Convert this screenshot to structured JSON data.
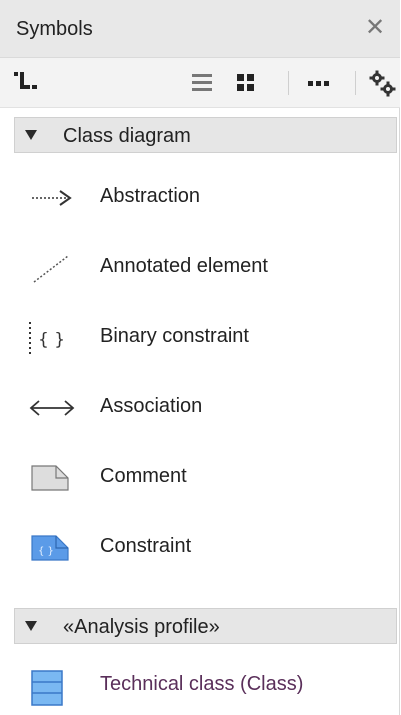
{
  "panel": {
    "title": "Symbols",
    "close_icon": "close-icon"
  },
  "toolbar": {
    "items": [
      {
        "name": "tree-layout-icon"
      },
      {
        "name": "list-view-icon"
      },
      {
        "name": "grid-view-icon"
      },
      {
        "name": "more-options-icon"
      },
      {
        "name": "settings-gear-icon"
      }
    ]
  },
  "groups": [
    {
      "label": "Class diagram",
      "items": [
        {
          "label": "Abstraction",
          "icon": "abstraction-arrow-icon"
        },
        {
          "label": "Annotated element",
          "icon": "dotted-line-icon"
        },
        {
          "label": "Binary constraint",
          "icon": "braces-constraint-icon"
        },
        {
          "label": "Association",
          "icon": "double-arrow-icon"
        },
        {
          "label": "Comment",
          "icon": "comment-note-icon"
        },
        {
          "label": "Constraint",
          "icon": "constraint-note-icon"
        }
      ]
    },
    {
      "label": "«Analysis profile»",
      "items": [
        {
          "label": "Technical class (Class)",
          "icon": "technical-class-icon"
        }
      ]
    }
  ],
  "colors": {
    "title_bg": "#e8e8e8",
    "group_bg": "#e6e6e6",
    "constraint_blue": "#4f8fe0",
    "class_blue": "#5aa0e6",
    "technical_label": "#5a2f5a"
  }
}
